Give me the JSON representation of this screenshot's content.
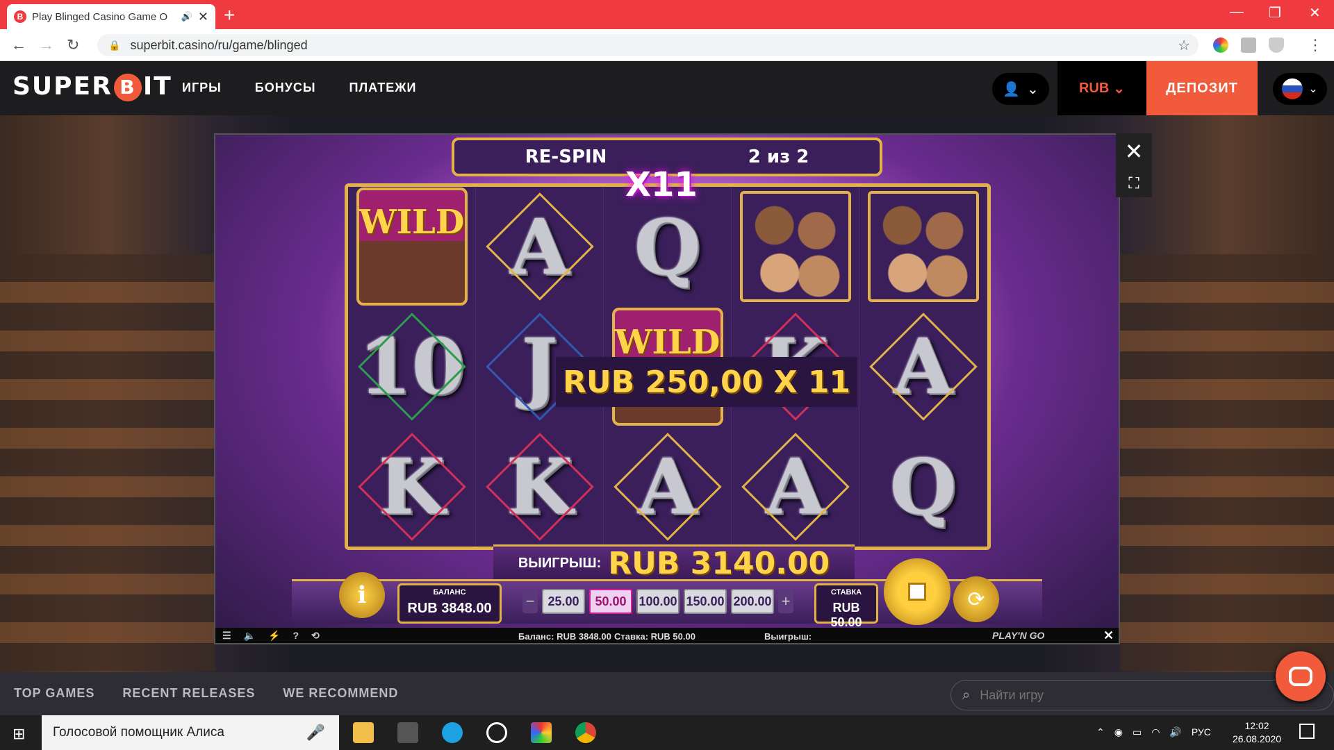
{
  "browser": {
    "tab_title": "Play Blinged Casino Game O",
    "favicon_letter": "B",
    "url": "superbit.casino/ru/game/blinged",
    "new_tab": "+",
    "win_min": "—",
    "win_max": "❐",
    "win_close": "✕"
  },
  "site": {
    "logo_left": "SUPER",
    "logo_b": "B",
    "logo_right": "IT",
    "nav": [
      "ИГРЫ",
      "БОНУСЫ",
      "ПЛАТЕЖИ"
    ],
    "currency": "RUB",
    "deposit": "ДЕПОЗИТ"
  },
  "game": {
    "respin_label": "RE-SPIN",
    "respin_count": "2 из 2",
    "multiplier": "X11",
    "win_line": "RUB 250,00 X 11",
    "reels": [
      [
        "WILD",
        "A",
        "Q",
        "people",
        "people"
      ],
      [
        "10",
        "J",
        "WILD",
        "K",
        "A"
      ],
      [
        "K",
        "K",
        "A",
        "A",
        "Q"
      ]
    ],
    "win_label": "ВЫИГРЫШ:",
    "win_value": "RUB 3140.00",
    "balance_label": "БАЛАНС",
    "balance_value": "RUB 3848.00",
    "bets": [
      "25.00",
      "50.00",
      "100.00",
      "150.00",
      "200.00"
    ],
    "selected_bet": "50.00",
    "stake_label": "СТАВКА",
    "stake_value": "RUB 50.00",
    "info": "i"
  },
  "status_bar": {
    "balance": "Баланс: RUB 3848.00",
    "stake": "Ставка: RUB 50.00",
    "win": "Выигрыш:",
    "provider": "PLAY'N GO"
  },
  "bottom": {
    "tabs": [
      "TOP GAMES",
      "RECENT RELEASES",
      "WE RECOMMEND"
    ],
    "search_placeholder": "Найти игру"
  },
  "taskbar": {
    "assistant": "Голосовой помощник Алиса",
    "lang": "РУС",
    "time": "12:02",
    "date": "26.08.2020"
  },
  "colors": {
    "accent": "#f15a3b",
    "browser_tab_bar": "#ef3b3f",
    "gold": "#e3b34a"
  }
}
